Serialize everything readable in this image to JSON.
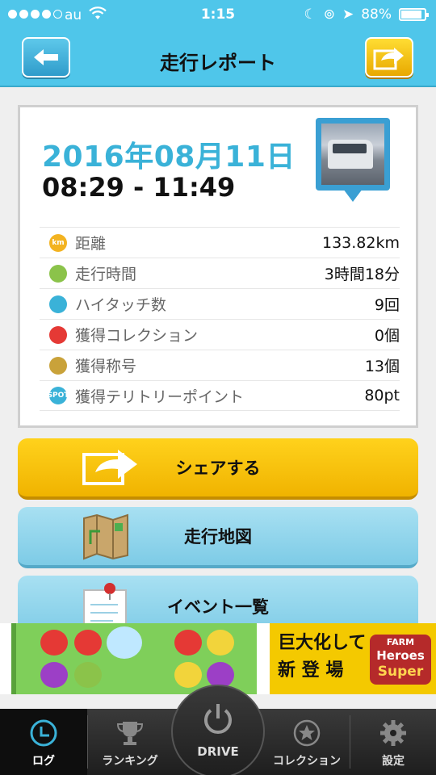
{
  "status_bar": {
    "carrier": "au",
    "time": "1:15",
    "battery": "88%",
    "battery_level": 0.88
  },
  "header": {
    "title": "走行レポート",
    "back_icon": "arrow-left-icon",
    "share_icon": "share-arrow-icon"
  },
  "report": {
    "date": "2016年08月11日",
    "time_range": "08:29 - 11:49",
    "stats": [
      {
        "icon": "km-icon",
        "icon_text": "km",
        "label": "距離",
        "value": "133.82km",
        "color": "#f3b321"
      },
      {
        "icon": "clock-icon",
        "icon_text": "",
        "label": "走行時間",
        "value": "3時間18分",
        "color": "#8bc34a"
      },
      {
        "icon": "hand-icon",
        "icon_text": "",
        "label": "ハイタッチ数",
        "value": "9回",
        "color": "#3ab2d8"
      },
      {
        "icon": "car-icon",
        "icon_text": "",
        "label": "獲得コレクション",
        "value": "0個",
        "color": "#e53935"
      },
      {
        "icon": "medal-icon",
        "icon_text": "",
        "label": "獲得称号",
        "value": "13個",
        "color": "#c9a23a"
      },
      {
        "icon": "spot-icon",
        "icon_text": "SPOT",
        "label": "獲得テリトリーポイント",
        "value": "80pt",
        "color": "#3ab2d8"
      }
    ]
  },
  "actions": {
    "share": "シェアする",
    "map": "走行地図",
    "events": "イベント一覧"
  },
  "ad": {
    "text_line1": "巨大化して",
    "text_line2": "新 登 場",
    "logo_line1": "FARM",
    "logo_line2": "Heroes",
    "logo_line3": "Super"
  },
  "tabs": {
    "log": "ログ",
    "ranking": "ランキング",
    "drive": "DRIVE",
    "collection": "コレクション",
    "settings": "設定"
  }
}
